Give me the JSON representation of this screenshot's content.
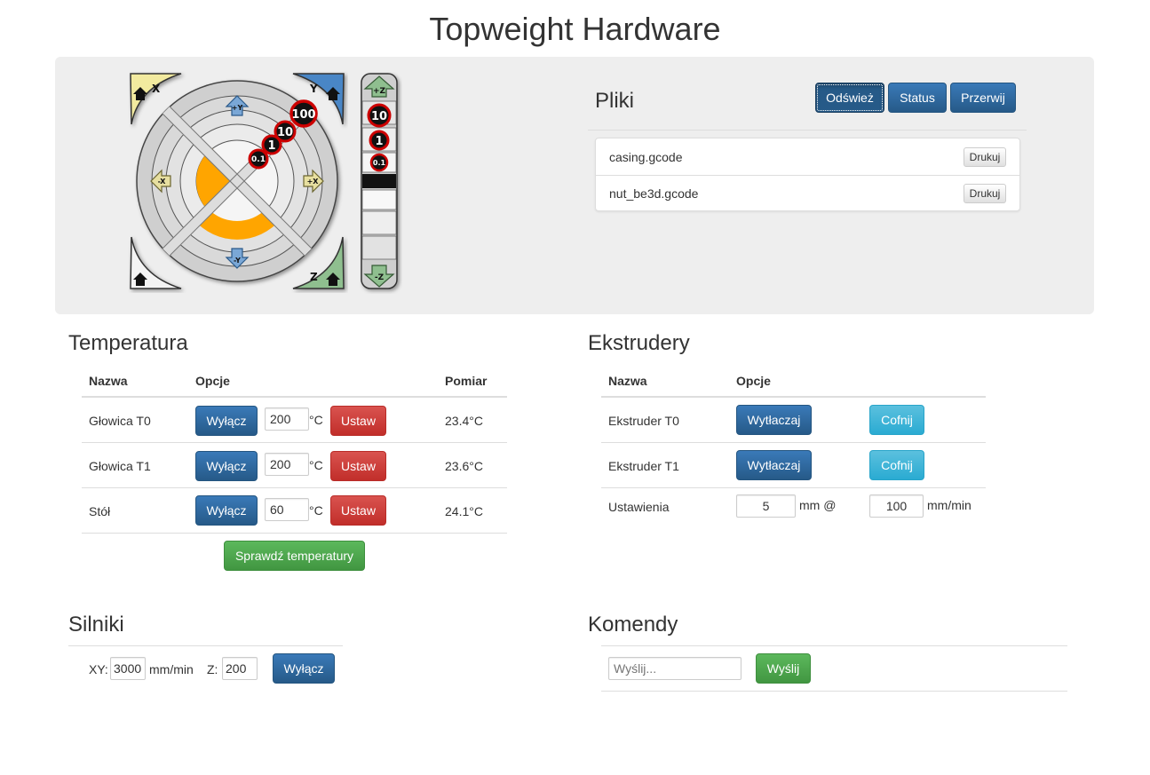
{
  "page": {
    "title": "Topweight Hardware"
  },
  "jog": {
    "corner_labels": {
      "home_x": "X",
      "home_y": "Y",
      "home_z": "Z"
    },
    "arrow_labels": {
      "plus_y": "+Y",
      "minus_y": "-Y",
      "plus_x": "+X",
      "minus_x": "-X",
      "plus_z": "+Z",
      "minus_z": "-Z"
    },
    "step_labels": [
      "0.1",
      "1",
      "10",
      "100"
    ],
    "z_step_labels": [
      "10",
      "1",
      "0.1"
    ]
  },
  "files": {
    "title": "Pliki",
    "buttons": {
      "refresh": "Odśwież",
      "status": "Status",
      "abort": "Przerwij"
    },
    "items": [
      {
        "name": "casing.gcode",
        "print_label": "Drukuj"
      },
      {
        "name": "nut_be3d.gcode",
        "print_label": "Drukuj"
      }
    ]
  },
  "temperature": {
    "title": "Temperatura",
    "headers": {
      "name": "Nazwa",
      "options": "Opcje",
      "measure": "Pomiar"
    },
    "unit": "°C",
    "rows": [
      {
        "name": "Głowica T0",
        "off_label": "Wyłącz",
        "value": "200",
        "set_label": "Ustaw",
        "measured": "23.4°C"
      },
      {
        "name": "Głowica T1",
        "off_label": "Wyłącz",
        "value": "200",
        "set_label": "Ustaw",
        "measured": "23.6°C"
      },
      {
        "name": "Stół",
        "off_label": "Wyłącz",
        "value": "60",
        "set_label": "Ustaw",
        "measured": "24.1°C"
      }
    ],
    "check_label": "Sprawdź temperatury"
  },
  "extruders": {
    "title": "Ekstrudery",
    "headers": {
      "name": "Nazwa",
      "options": "Opcje"
    },
    "rows": [
      {
        "name": "Ekstruder T0",
        "extrude_label": "Wytłaczaj",
        "retract_label": "Cofnij"
      },
      {
        "name": "Ekstruder T1",
        "extrude_label": "Wytłaczaj",
        "retract_label": "Cofnij"
      }
    ],
    "settings": {
      "label": "Ustawienia",
      "length": "5",
      "length_unit": "mm @",
      "speed": "100",
      "speed_unit": "mm/min"
    }
  },
  "motors": {
    "title": "Silniki",
    "xy_label": "XY:",
    "xy_value": "3000",
    "xy_unit": "mm/min",
    "z_label": "Z:",
    "z_value": "200",
    "off_label": "Wyłącz"
  },
  "commands": {
    "title": "Komendy",
    "placeholder": "Wyślij...",
    "send_label": "Wyślij"
  },
  "colors": {
    "primary": "#2e6da4",
    "danger": "#d9534f",
    "success": "#5cb85c",
    "info": "#5bc0de",
    "jog_orange": "#ffa500",
    "corner_x": "#f3eba0",
    "corner_y": "#4a86c6",
    "corner_z": "#8fbf8f"
  }
}
